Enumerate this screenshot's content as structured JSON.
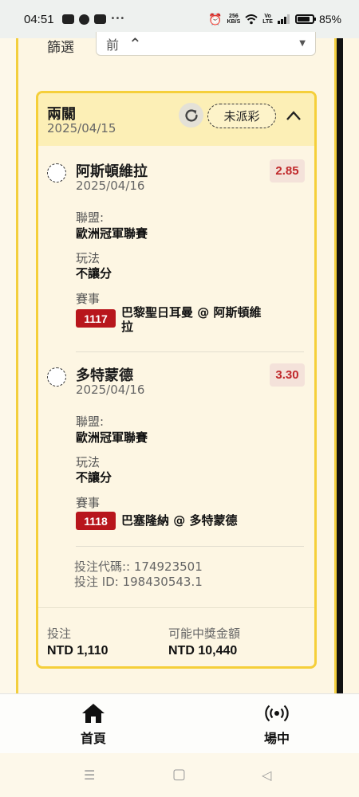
{
  "status_bar": {
    "time": "04:51",
    "net_speed_top": "256",
    "net_speed_bottom": "KB/S",
    "vo_top": "Vo",
    "vo_bottom": "LTE",
    "battery_percent": "85%",
    "battery_level": 0.85
  },
  "filter": {
    "label": "篩選",
    "selected_value": "前"
  },
  "bet_card": {
    "title": "兩關",
    "date": "2025/04/15",
    "status": "未派彩",
    "legs": [
      {
        "team": "阿斯頓維拉",
        "date": "2025/04/16",
        "odds": "2.85",
        "league_label": "聯盟:",
        "league": "歐洲冠軍聯賽",
        "market_label": "玩法",
        "market": "不讓分",
        "event_label": "賽事",
        "match_id": "1117",
        "match_name": "巴黎聖日耳曼 @ 阿斯頓維拉"
      },
      {
        "team": "多特蒙德",
        "date": "2025/04/16",
        "odds": "3.30",
        "league_label": "聯盟:",
        "league": "歐洲冠軍聯賽",
        "market_label": "玩法",
        "market": "不讓分",
        "event_label": "賽事",
        "match_id": "1118",
        "match_name": "巴塞隆納 @ 多特蒙德"
      }
    ],
    "bet_code": "投注代碼:: 174923501",
    "bet_id": "投注 ID: 198430543.1",
    "stake_label": "投注",
    "stake_value": "NTD 1,110",
    "payout_label": "可能中獎金額",
    "payout_value": "NTD 10,440"
  },
  "bottom_nav": {
    "home_label": "首頁",
    "live_label": "場中"
  },
  "icons": {
    "refresh": "refresh-icon",
    "collapse": "chevron-up-icon",
    "home": "home-icon",
    "live": "broadcast-icon"
  },
  "colors": {
    "accent_yellow": "#f5cf3a",
    "odds_red": "#c0282b",
    "badge_red": "#b8161c"
  }
}
